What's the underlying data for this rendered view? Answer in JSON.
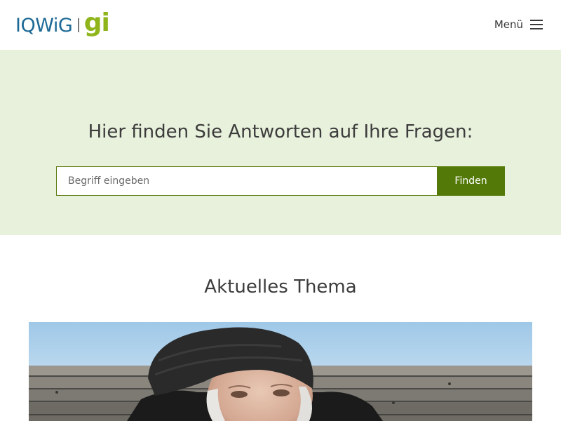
{
  "header": {
    "logo": {
      "primary": "IQWiG",
      "secondary": "gi"
    },
    "menu_label": "Menü",
    "menu_icon": "hamburger-icon"
  },
  "hero": {
    "title": "Hier finden Sie Antworten auf Ihre Fragen:",
    "search": {
      "placeholder": "Begriff eingeben",
      "value": "",
      "button_label": "Finden"
    }
  },
  "current_topic": {
    "heading": "Aktuelles Thema"
  },
  "colors": {
    "brand_blue": "#1d6a96",
    "brand_green": "#8fb51b",
    "hero_background": "#e8f1dc",
    "button_green": "#537a08",
    "input_border": "#5a7a10"
  }
}
